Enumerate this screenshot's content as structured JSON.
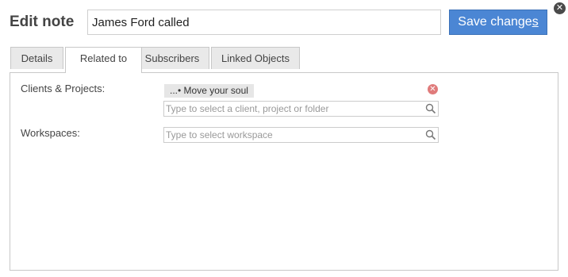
{
  "dialog": {
    "title": "Edit note",
    "note_title_value": "James Ford called",
    "save_prefix": "Save change",
    "save_underlined": "s",
    "close_icon": "close-icon"
  },
  "tabs": [
    {
      "label": "Details",
      "active": false
    },
    {
      "label": "Related to",
      "active": true
    },
    {
      "label": "Subscribers",
      "active": false
    },
    {
      "label": "Linked Objects",
      "active": false
    }
  ],
  "related": {
    "clients_label": "Clients & Projects:",
    "selected_chip": "...• Move your soul",
    "clients_placeholder": "Type to select a client, project or folder",
    "workspaces_label": "Workspaces:",
    "workspaces_placeholder": "Type to select workspace"
  },
  "colors": {
    "accent": "#4b86d4",
    "remove": "#e07b7b"
  }
}
